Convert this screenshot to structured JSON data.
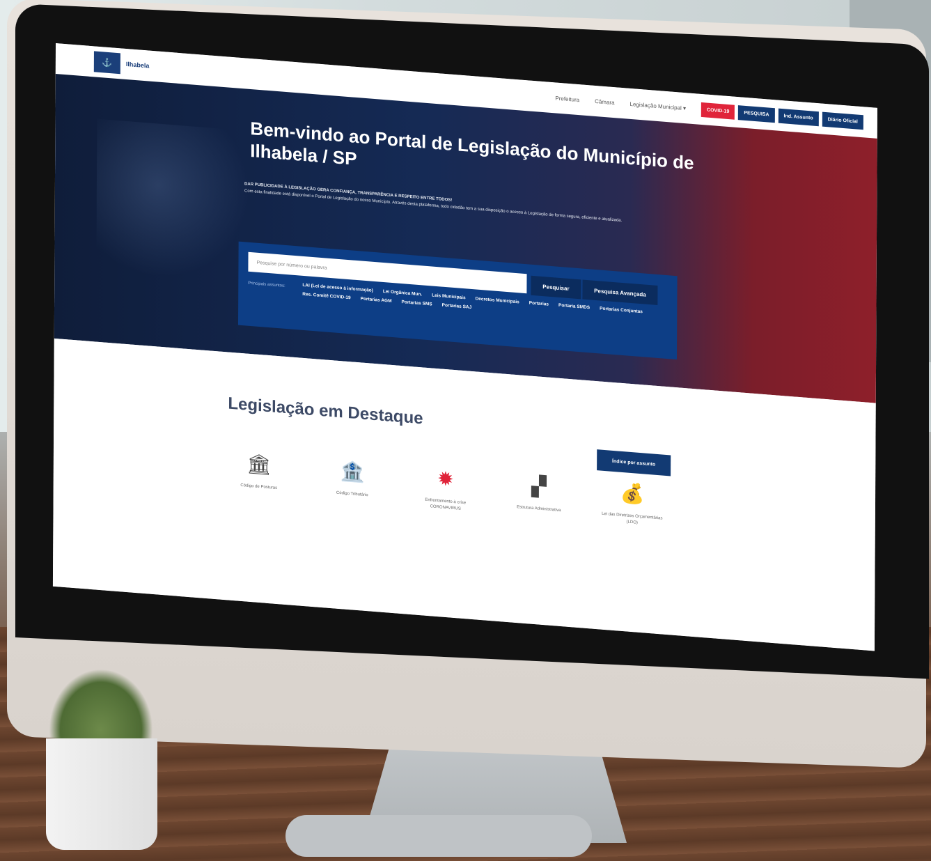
{
  "topbar": {
    "logo_text": "Ilhabela",
    "nav": [
      "Prefeitura",
      "Câmara",
      "Legislação Municipal ▾"
    ],
    "buttons": [
      "COVID-19",
      "PESQUISA",
      "Ind. Assunto",
      "Diário Oficial"
    ]
  },
  "hero": {
    "title": "Bem-vindo ao Portal de Legislação do Município de Ilhabela / SP",
    "sub_heading": "DAR PUBLICIDADE À LEGISLAÇÃO GERA CONFIANÇA, TRANSPARÊNCIA E RESPEITO ENTRE TODOS!",
    "sub_text": "Com esta finalidade está disponível o Portal de Legislação do nosso Município. Através desta plataforma, todo cidadão tem a sua disposição o acesso à Legislação de forma segura, eficiente e atualizada."
  },
  "search": {
    "placeholder": "Pesquise por número ou palavra",
    "search_button": "Pesquisar",
    "advanced_button": "Pesquisa Avançada",
    "topics_label": "Principais assuntos:",
    "topics": [
      "LAI (Lei de acesso à informação)",
      "Lei Orgânica Mun.",
      "Leis Municipais",
      "Decretos Municipais",
      "Portarias",
      "Portaria SMDS",
      "Portarias Conjuntas",
      "Res. Comitê COVID-19",
      "Portarias AGM",
      "Portarias SMS",
      "Portarias SAJ"
    ]
  },
  "content": {
    "section_title": "Legislação em Destaque",
    "index_button": "Índice por assunto",
    "highlights": [
      {
        "icon": "bank-icon",
        "label": "Código de Posturas"
      },
      {
        "icon": "bank-dollar-icon",
        "label": "Código Tributário"
      },
      {
        "icon": "virus-icon",
        "label": "Enfrentamento à crise CORONAVIRUS"
      },
      {
        "icon": "org-chart-icon",
        "label": "Estrutura Administrativa"
      },
      {
        "icon": "money-bag-icon",
        "label": "Lei das Diretrizes Orçamentárias (LDO)"
      }
    ]
  },
  "colors": {
    "navy": "#123a73",
    "red": "#e0243a",
    "search_panel": "#0d3e86"
  }
}
